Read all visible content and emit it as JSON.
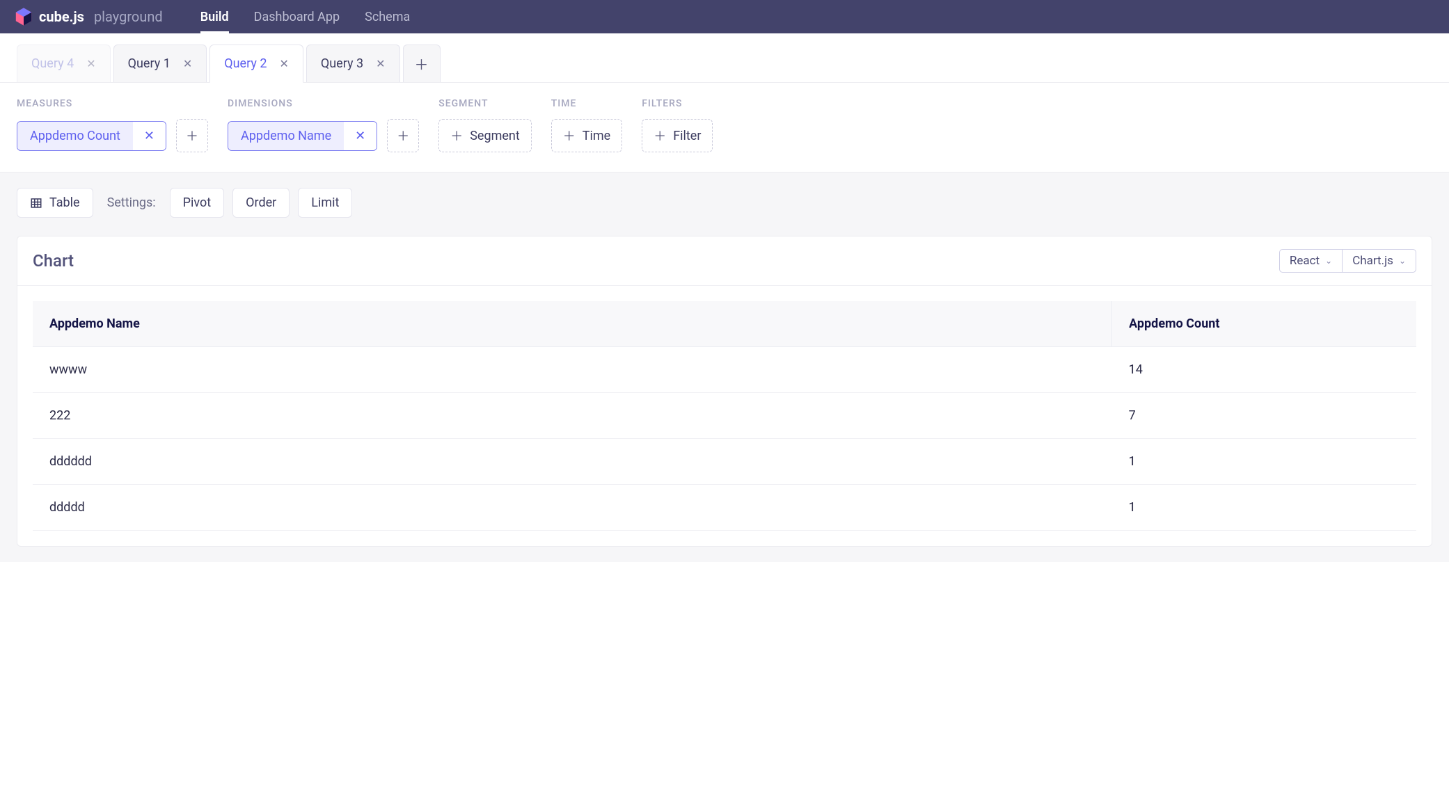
{
  "logo": {
    "brand": "cube.js",
    "sub": "playground"
  },
  "nav": {
    "items": [
      {
        "label": "Build",
        "active": true
      },
      {
        "label": "Dashboard App",
        "active": false
      },
      {
        "label": "Schema",
        "active": false
      }
    ]
  },
  "queryTabs": {
    "tabs": [
      {
        "label": "Query 4",
        "active": false,
        "dragging": true
      },
      {
        "label": "Query 1",
        "active": false,
        "dragging": false
      },
      {
        "label": "Query 2",
        "active": true,
        "dragging": false
      },
      {
        "label": "Query 3",
        "active": false,
        "dragging": false
      }
    ]
  },
  "builder": {
    "sections": {
      "measures": {
        "label": "MEASURES",
        "chips": [
          "Appdemo Count"
        ]
      },
      "dimensions": {
        "label": "DIMENSIONS",
        "chips": [
          "Appdemo Name"
        ]
      },
      "segment": {
        "label": "SEGMENT",
        "placeholder": "Segment"
      },
      "time": {
        "label": "TIME",
        "placeholder": "Time"
      },
      "filters": {
        "label": "FILTERS",
        "placeholder": "Filter"
      }
    }
  },
  "settingsRow": {
    "view": "Table",
    "label": "Settings:",
    "buttons": {
      "pivot": "Pivot",
      "order": "Order",
      "limit": "Limit"
    }
  },
  "chart": {
    "title": "Chart",
    "frameworkSelect": "React",
    "librarySelect": "Chart.js"
  },
  "resultsTable": {
    "columns": [
      "Appdemo Name",
      "Appdemo Count"
    ],
    "rows": [
      {
        "name": "wwww",
        "count": "14"
      },
      {
        "name": "222",
        "count": "7"
      },
      {
        "name": "dddddd",
        "count": "1"
      },
      {
        "name": "ddddd",
        "count": "1"
      }
    ]
  },
  "chart_data": {
    "type": "table",
    "columns": [
      "Appdemo Name",
      "Appdemo Count"
    ],
    "rows": [
      [
        "wwww",
        14
      ],
      [
        "222",
        7
      ],
      [
        "dddddd",
        1
      ],
      [
        "ddddd",
        1
      ]
    ]
  }
}
